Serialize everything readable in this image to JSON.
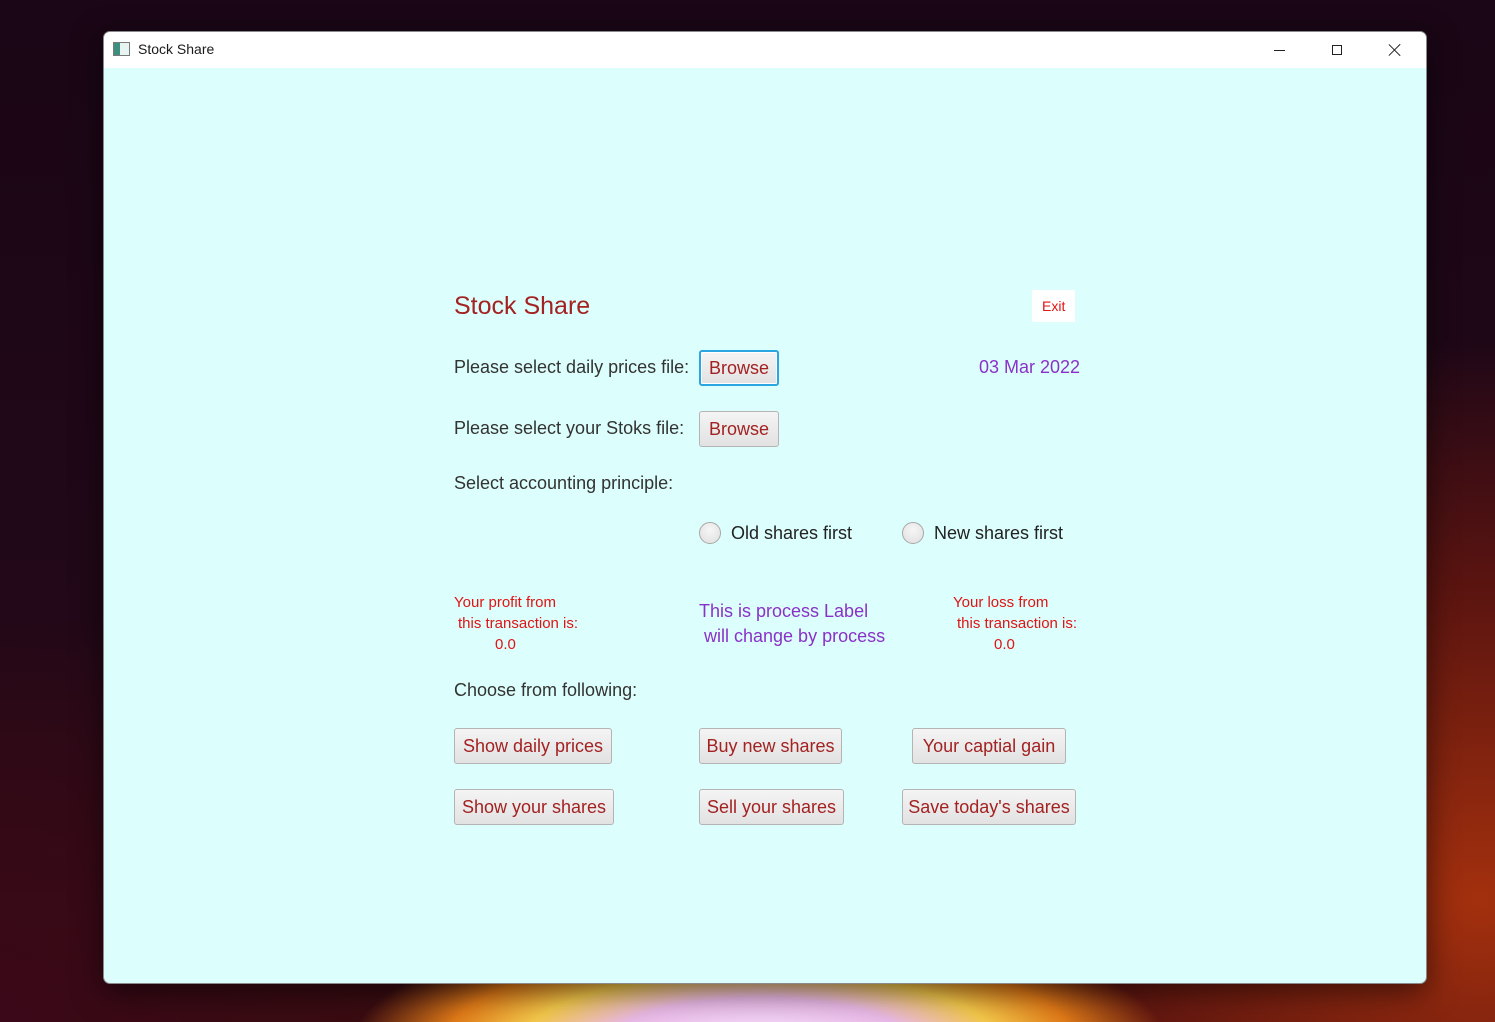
{
  "window": {
    "title": "Stock Share"
  },
  "app": {
    "title": "Stock Share",
    "exit_label": "Exit",
    "date": "03 Mar 2022",
    "daily_prices_prompt": "Please select daily prices file:",
    "stocks_prompt": "Please select your Stoks file:",
    "browse_label": "Browse",
    "accounting_prompt": "Select accounting principle:",
    "radio_options": [
      "Old shares first",
      "New shares first"
    ],
    "profit": {
      "line1": "Your profit from",
      "line2": "this transaction is:",
      "value": "0.0"
    },
    "process_label": {
      "line1": "This is process Label",
      "line2": "will change by process"
    },
    "loss": {
      "line1": "Your loss from",
      "line2": "this transaction is:",
      "value": "0.0"
    },
    "choose_prompt": "Choose from following:",
    "actions": {
      "show_daily_prices": "Show daily prices",
      "buy_new_shares": "Buy new shares",
      "capital_gain": "Your captial gain",
      "show_your_shares": "Show your shares",
      "sell_your_shares": "Sell your shares",
      "save_todays_shares": "Save today's shares"
    }
  },
  "colors": {
    "background": "#dcfefc",
    "title_red": "#a32222",
    "accent_purple": "#8a32c8",
    "value_red": "#e01414"
  }
}
